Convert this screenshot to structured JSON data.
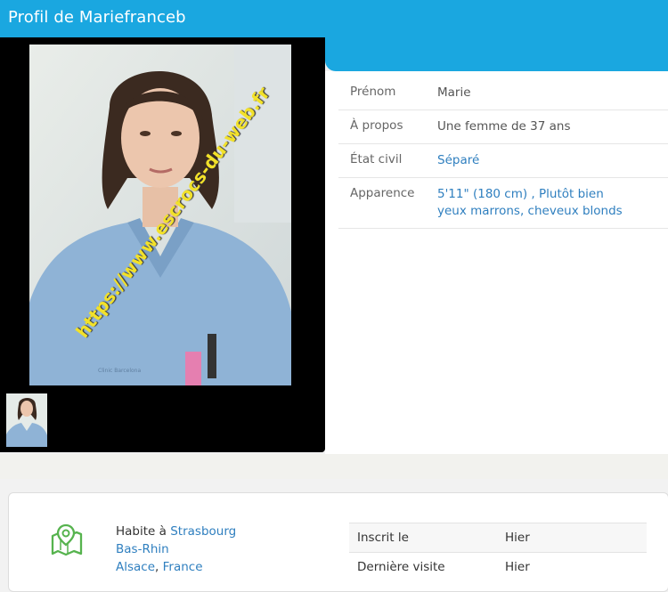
{
  "header": {
    "title": "Profil de Mariefranceb"
  },
  "photo": {
    "watermark": "https://www.escrocs-du-web.fr",
    "badge": "Clinic Barcelona"
  },
  "profile": [
    {
      "label": "Prénom",
      "value": "Marie"
    },
    {
      "label": "À propos",
      "value": "Une femme de 37 ans"
    },
    {
      "label": "État civil",
      "value": "Séparé"
    },
    {
      "label": "Apparence",
      "line1": "5'11\" (180 cm) , Plutôt bien",
      "line2": "yeux marrons, cheveux blonds"
    }
  ],
  "location": {
    "prefix": "Habite à",
    "city": "Strasbourg",
    "region": "Bas-Rhin",
    "area": "Alsace",
    "separator": ", ",
    "country": "France"
  },
  "stats": [
    {
      "label": "Inscrit le",
      "value": "Hier"
    },
    {
      "label": "Dernière visite",
      "value": "Hier"
    }
  ],
  "colors": {
    "accent": "#1aa7e0",
    "link": "#2f7fbf"
  },
  "icons": {
    "location": "map-pin-icon"
  }
}
